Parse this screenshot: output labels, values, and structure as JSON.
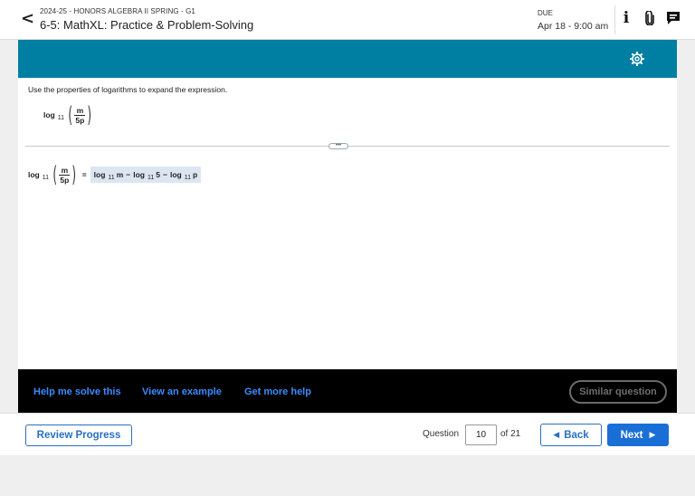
{
  "header": {
    "back_glyph": "<",
    "course": "2024-25 - HONORS ALGEBRA II SPRING - G1",
    "assignment": "6-5: MathXL: Practice & Problem-Solving",
    "due_label": "DUE",
    "due_value": "Apr 18 - 9:00 am",
    "info_glyph": "i"
  },
  "question": {
    "instruction": "Use the properties of logarithms to expand the expression.",
    "expression": {
      "log": "log",
      "base": "11",
      "numerator": "m",
      "denominator": "5p"
    },
    "divider_handle": "•••"
  },
  "answer": {
    "lhs": {
      "log": "log",
      "base": "11",
      "numerator": "m",
      "denominator": "5p"
    },
    "equals": "=",
    "terms": [
      {
        "log": "log",
        "base": "11",
        "arg": "m"
      },
      {
        "op": "−"
      },
      {
        "log": "log",
        "base": "11",
        "arg": "5"
      },
      {
        "op": "−"
      },
      {
        "log": "log",
        "base": "11",
        "arg": "p"
      }
    ]
  },
  "help": {
    "help_solve": "Help me solve this",
    "view_example": "View an example",
    "more_help": "Get more help",
    "similar": "Similar question"
  },
  "footer": {
    "review": "Review Progress",
    "question_label": "Question",
    "question_number": "10",
    "question_total": "of 21",
    "back": "Back",
    "next": "Next"
  },
  "colors": {
    "teal": "#007fa3",
    "link_blue": "#3b8bff",
    "primary": "#1a6fd6",
    "answer_bg": "#dce6f2"
  }
}
